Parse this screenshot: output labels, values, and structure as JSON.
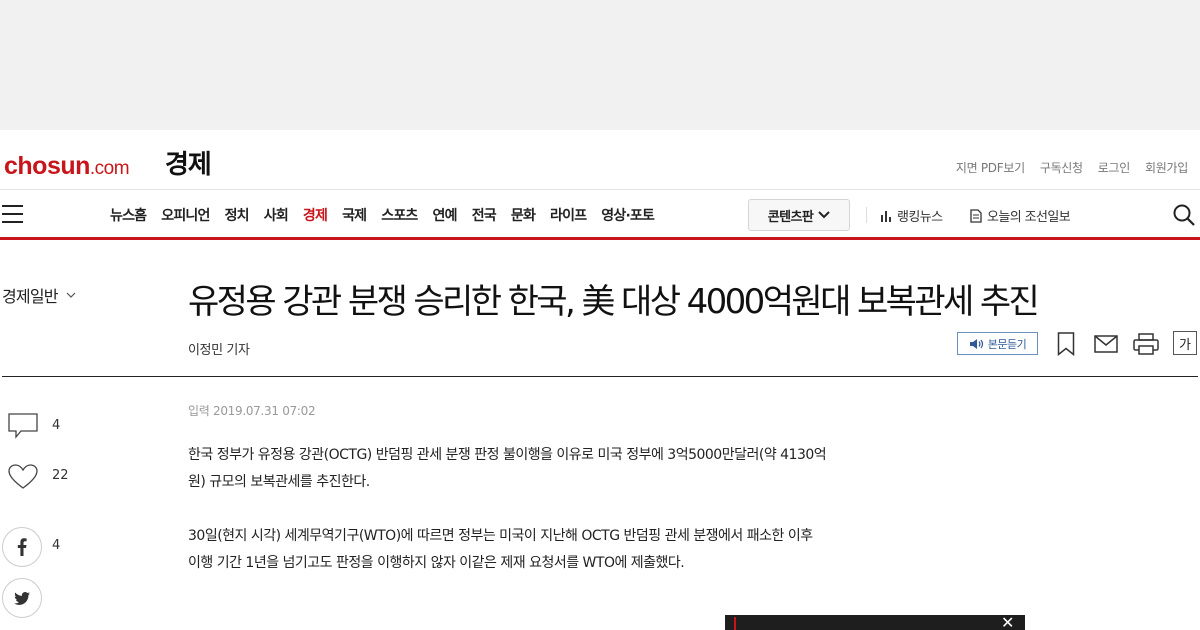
{
  "site": {
    "logo_main": "chosun",
    "logo_suffix": ".com",
    "section": "경제",
    "util_links": [
      "지면 PDF보기",
      "구독신청",
      "로그인",
      "회원가입"
    ]
  },
  "nav": {
    "items": [
      "뉴스홈",
      "오피니언",
      "정치",
      "사회",
      "경제",
      "국제",
      "스포츠",
      "연예",
      "전국",
      "문화",
      "라이프",
      "영상·포토"
    ],
    "active": "경제",
    "contents_button": "콘텐츠판",
    "ranking": "랭킹뉴스",
    "today": "오늘의 조선일보"
  },
  "article": {
    "subsection": "경제일반",
    "headline": "유정용 강관 분쟁 승리한 한국, 美 대상 4000억원대 보복관세 추진",
    "byline": "이정민 기자",
    "audio_button": "본문듣기",
    "font_button": "가",
    "dateline": "입력 2019.07.31 07:02",
    "paragraphs": [
      "한국 정부가 유정용 강관(OCTG) 반덤핑 관세 분쟁 판정 불이행을 이유로 미국 정부에 3억5000만달러(약 4130억원) 규모의 보복관세를 추진한다.",
      "30일(현지 시각) 세계무역기구(WTO)에 따르면 정부는 미국이 지난해 OCTG 반덤핑 관세 분쟁에서 패소한 이후 이행 기간 1년을 넘기고도 판정을 이행하지 않자 이같은 제재 요청서를 WTO에 제출했다."
    ]
  },
  "social": {
    "comment_count": "4",
    "like_count": "22",
    "facebook_count": "4"
  },
  "colors": {
    "brand": "#c7151b",
    "audio": "#305a9a"
  }
}
